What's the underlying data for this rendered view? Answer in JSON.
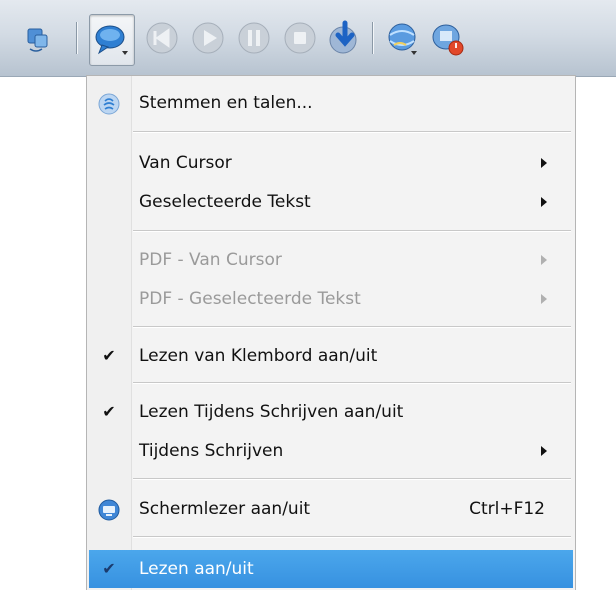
{
  "toolbar": {
    "buttons": [
      {
        "icon": "convert-icon"
      },
      {
        "icon": "speech-bubble-menu-icon",
        "pressed": true
      },
      {
        "icon": "previous-icon",
        "disabled": true
      },
      {
        "icon": "play-icon",
        "disabled": true
      },
      {
        "icon": "pause-icon",
        "disabled": true
      },
      {
        "icon": "stop-icon",
        "disabled": true
      },
      {
        "icon": "download-audio-icon"
      },
      {
        "icon": "globe-menu-icon"
      },
      {
        "icon": "document-power-icon"
      }
    ]
  },
  "menu": {
    "voices": "Stemmen en talen...",
    "from_cursor": "Van Cursor",
    "selected_text": "Geselecteerde Tekst",
    "pdf_from_cursor": "PDF - Van Cursor",
    "pdf_selected_text": "PDF - Geselecteerde Tekst",
    "clipboard_reading": "Lezen van Klembord aan/uit",
    "read_while_typing": "Lezen Tijdens Schrijven aan/uit",
    "while_typing": "Tijdens Schrijven",
    "screen_reader": "Schermlezer aan/uit",
    "screen_reader_shortcut": "Ctrl+F12",
    "reading_toggle": "Lezen aan/uit"
  },
  "colors": {
    "highlight": "#3f9be6",
    "disabled_text": "#9a9a9a"
  }
}
